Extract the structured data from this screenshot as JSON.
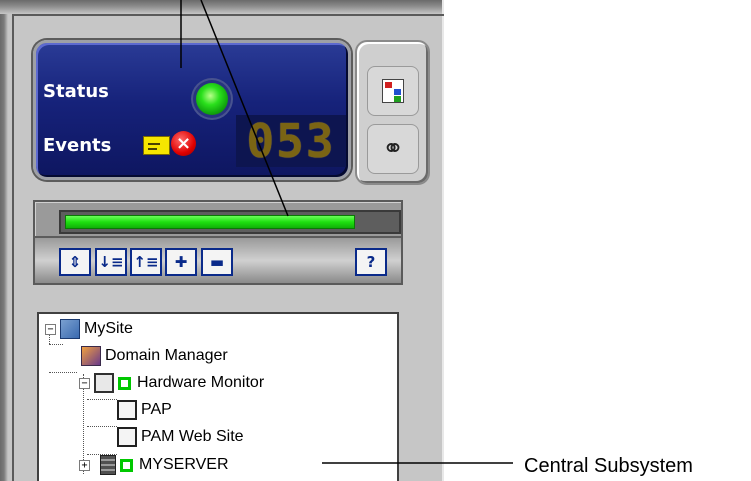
{
  "status_panel": {
    "status_label": "Status",
    "events_label": "Events",
    "event_counter": "053",
    "status_color": "#22dd1a",
    "error_icon": "x-circle-icon",
    "message_icon": "envelope-icon"
  },
  "side_tools": {
    "items": [
      {
        "icon": "tree-view-icon"
      },
      {
        "icon": "binoculars-icon"
      }
    ]
  },
  "progress": {
    "value": 0.88,
    "color": "#1ee010"
  },
  "toolbar": {
    "buttons": [
      {
        "icon": "refresh-icon",
        "glyph": "⇕"
      },
      {
        "icon": "expand-all-icon",
        "glyph": "↓≡"
      },
      {
        "icon": "collapse-all-icon",
        "glyph": "↑≡"
      },
      {
        "icon": "add-node-icon",
        "glyph": "✚"
      },
      {
        "icon": "stack-icon",
        "glyph": "▬"
      },
      {
        "icon": "help-icon",
        "glyph": "?"
      }
    ]
  },
  "tree": {
    "items": [
      {
        "label": "MySite",
        "icon": "site-icon",
        "expander": "−"
      },
      {
        "label": "Domain Manager",
        "icon": "domain-manager-icon"
      },
      {
        "label": "Hardware Monitor",
        "icon": "hardware-monitor-icon",
        "expander": "−",
        "status": "green"
      },
      {
        "label": "PAP",
        "icon": "pap-icon"
      },
      {
        "label": "PAM Web Site",
        "icon": "web-site-icon"
      },
      {
        "label": "MYSERVER",
        "icon": "server-icon",
        "expander": "+",
        "status": "green"
      }
    ]
  },
  "annotation": {
    "label": "Central Subsystem"
  }
}
